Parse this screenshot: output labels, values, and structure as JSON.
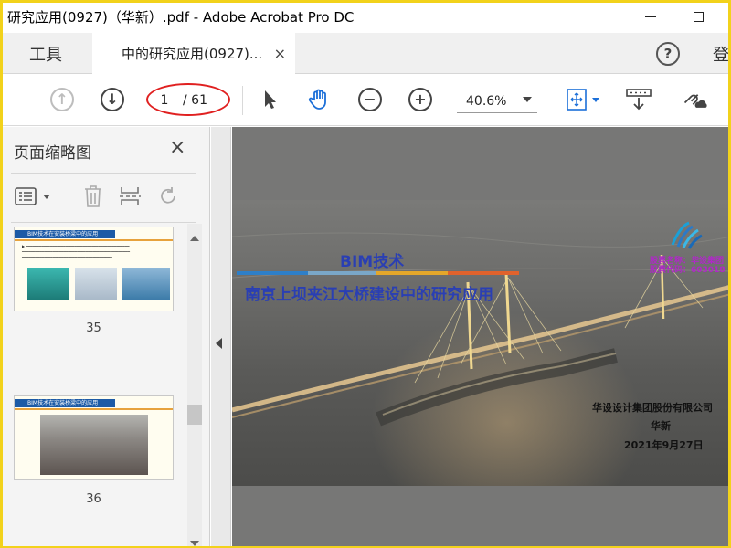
{
  "window": {
    "title": "研究应用(0927)（华新）.pdf - Adobe Acrobat Pro DC"
  },
  "tabs": {
    "tools_label": "工具",
    "document_label": "中的研究应用(0927)...",
    "close_symbol": "×",
    "help_symbol": "?",
    "login_label": "登"
  },
  "toolbar": {
    "current_page": "1",
    "page_total": "/ 61",
    "zoom": "40.6%"
  },
  "icons": [
    "arrow-up-icon",
    "arrow-down-icon",
    "select-arrow-icon",
    "hand-icon",
    "zoom-out-icon",
    "zoom-in-icon",
    "fit-page-icon",
    "scroll-mode-icon",
    "link-cloud-icon"
  ],
  "thumbnail_panel": {
    "title": "页面缩略图",
    "close_symbol": "×",
    "tools": [
      "options-icon",
      "delete-icon",
      "extract-icon",
      "rotate-icon"
    ],
    "pages": [
      {
        "label": "35",
        "heading": "BIM技术在安装桥梁中的应用"
      },
      {
        "label": "36",
        "heading": "BIM技术在安装桥梁中的应用"
      }
    ]
  },
  "pdf_page": {
    "title_line1": "BIM技术",
    "title_line2": "南京上坝夹江大桥建设中的研究应用",
    "stock_name": "股票名称：华设集团",
    "stock_code": "股票代码：603018",
    "company": "华设设计集团股份有限公司",
    "author": "华新",
    "date": "2021年9月27日",
    "bar_colors": [
      "#2e7fc8",
      "#7aa7c8",
      "#e4a72a",
      "#e0622c"
    ]
  },
  "colors": {
    "annotation_oval": "#e02020",
    "frame": "#f2d21b",
    "title_blue": "#2a3fb3"
  }
}
